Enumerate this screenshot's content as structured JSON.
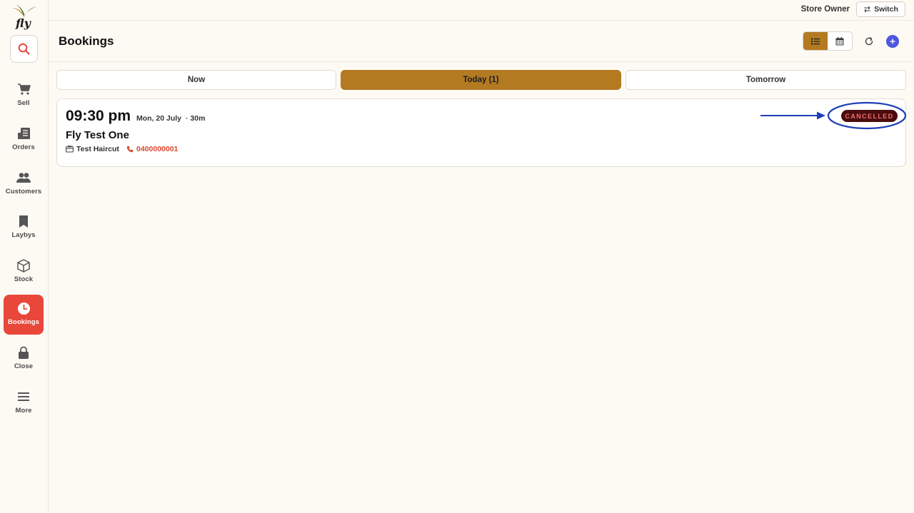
{
  "app": {
    "logo_text": "fly"
  },
  "sidebar": {
    "items": [
      {
        "label": "Sell",
        "icon": "cart-icon"
      },
      {
        "label": "Orders",
        "icon": "receipt-icon"
      },
      {
        "label": "Customers",
        "icon": "people-icon"
      },
      {
        "label": "Laybys",
        "icon": "bookmark-icon"
      },
      {
        "label": "Stock",
        "icon": "box-icon"
      },
      {
        "label": "Bookings",
        "icon": "clock-icon",
        "active": true
      },
      {
        "label": "Close",
        "icon": "lock-icon"
      },
      {
        "label": "More",
        "icon": "menu-icon"
      }
    ]
  },
  "topbar": {
    "user": "Store Owner",
    "switch_label": "Switch"
  },
  "header": {
    "title": "Bookings"
  },
  "tabs": [
    {
      "label": "Now"
    },
    {
      "label": "Today (1)",
      "active": true
    },
    {
      "label": "Tomorrow"
    }
  ],
  "booking": {
    "time": "09:30 pm",
    "date": "Mon, 20 July",
    "duration": "· 30m",
    "customer": "Fly Test One",
    "service": "Test Haircut",
    "phone": "0400000001",
    "status": "CANCELLED"
  },
  "colors": {
    "accent": "#b47a22",
    "active_nav": "#e8473a",
    "add_button": "#4f56e0",
    "phone": "#d9472f",
    "status_bg": "#4a0d0d",
    "annotation": "#1f3fb8"
  }
}
